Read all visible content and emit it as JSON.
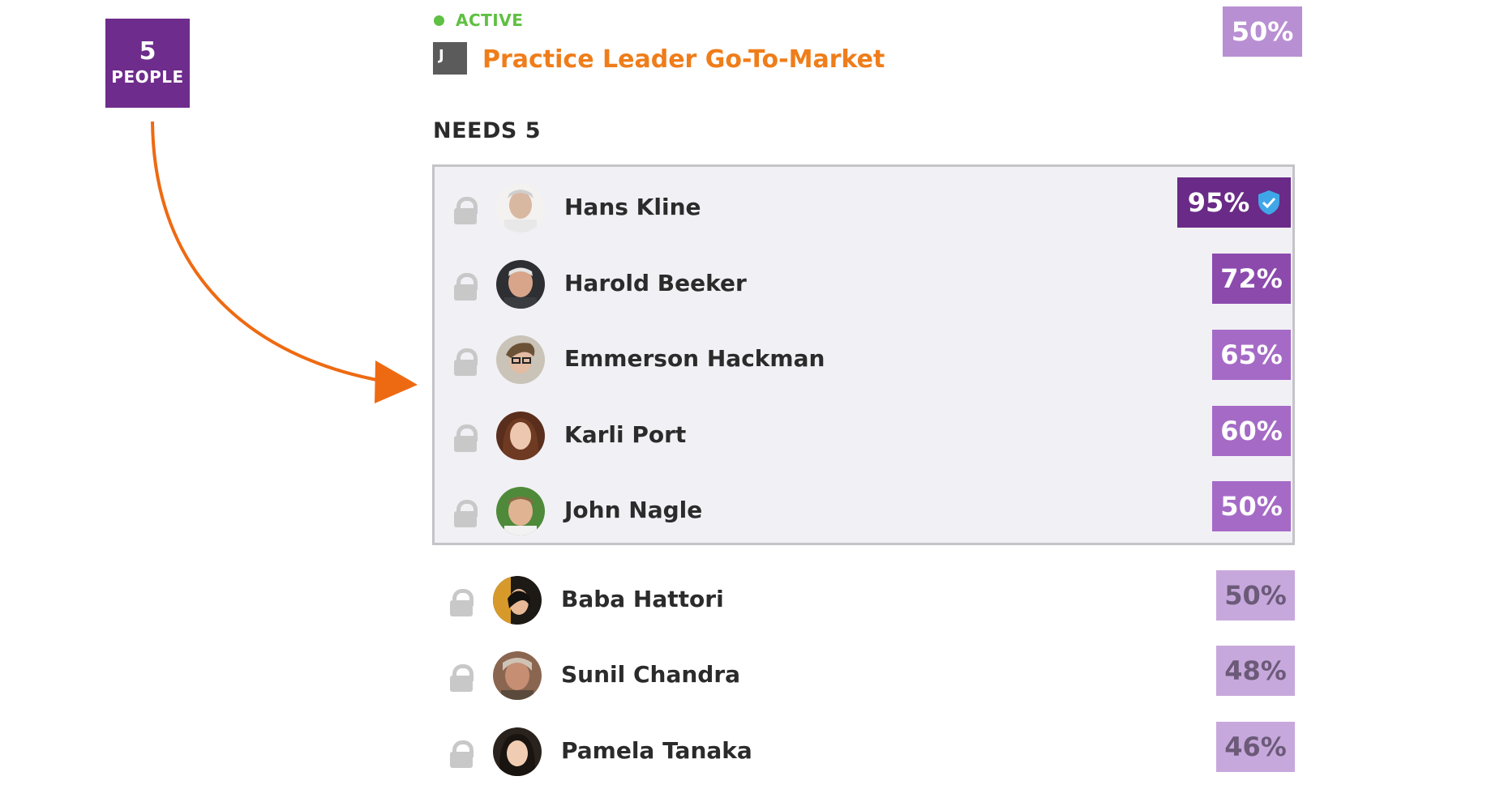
{
  "summary_badge": {
    "count": "5",
    "label": "PEOPLE"
  },
  "role": {
    "status": "ACTIVE",
    "icon_letter": "J",
    "title": "Practice Leader Go-To-Market",
    "match": "50%"
  },
  "needs_label": "NEEDS 5",
  "selected_candidates": [
    {
      "name": "Hans Kline",
      "match": "95%",
      "verified": true,
      "badge_color": "#6a2a87"
    },
    {
      "name": "Harold Beeker",
      "match": "72%",
      "badge_color": "#8c4aad"
    },
    {
      "name": "Emmerson Hackman",
      "match": "65%",
      "badge_color": "#a56ac6"
    },
    {
      "name": "Karli Port",
      "match": "60%",
      "badge_color": "#a56ac6"
    },
    {
      "name": "John Nagle",
      "match": "50%",
      "badge_color": "#a56ac6"
    }
  ],
  "other_candidates": [
    {
      "name": "Baba Hattori",
      "match": "50%",
      "badge_color": "#c7a8dc"
    },
    {
      "name": "Sunil Chandra",
      "match": "48%",
      "badge_color": "#c7a8dc"
    },
    {
      "name": "Pamela Tanaka",
      "match": "46%",
      "badge_color": "#c7a8dc"
    }
  ],
  "colors": {
    "accent_orange": "#ef7d1a",
    "brand_purple": "#6e2c8c",
    "active_green": "#5fc043"
  },
  "icons": {
    "lock": "unlocked-lock-icon",
    "verified": "verified-shield-icon",
    "arrow": "curved-arrow-icon"
  }
}
